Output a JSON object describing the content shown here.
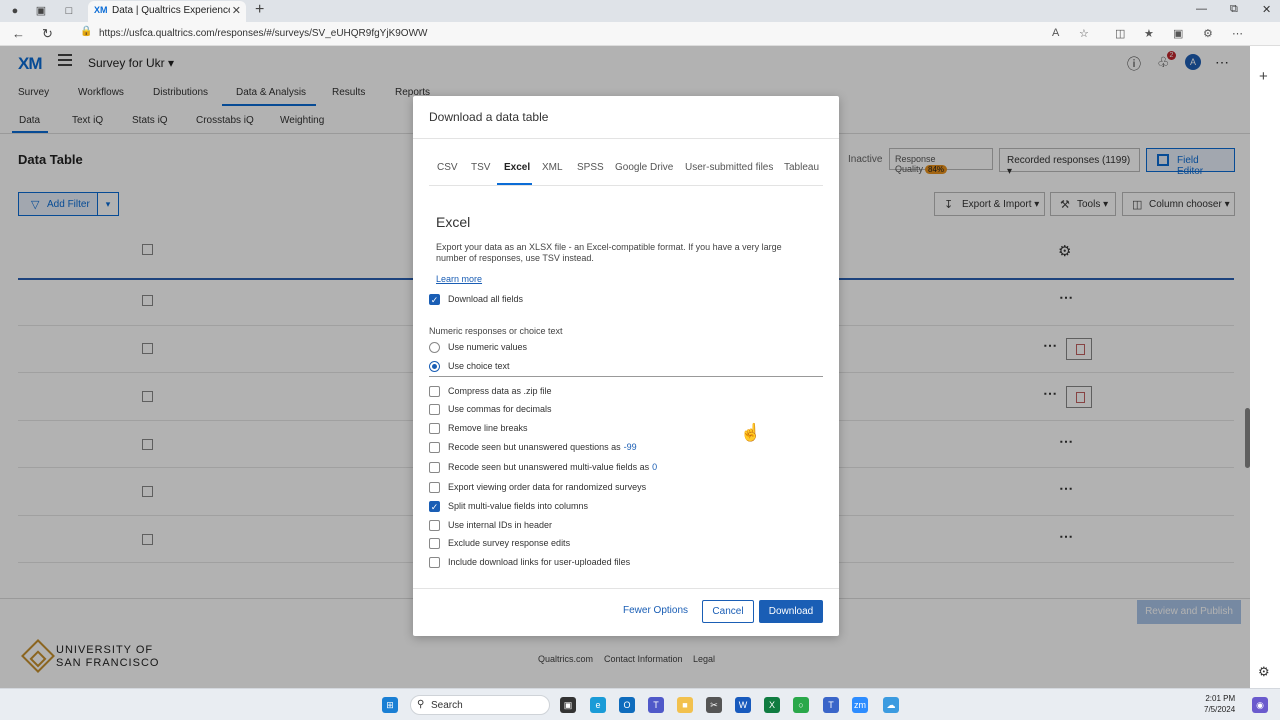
{
  "browser": {
    "tab_title": "Data | Qualtrics Experience Mana",
    "tab_logo": "XM",
    "url": "https://usfca.qualtrics.com/responses/#/surveys/SV_eUHQR9fgYjK9OWW"
  },
  "header": {
    "logo": "XM",
    "project": "Survey for Ukr",
    "avatar_initial": "A",
    "notification_count": "2"
  },
  "main_nav": [
    "Survey",
    "Workflows",
    "Distributions",
    "Data & Analysis",
    "Results",
    "Reports"
  ],
  "sub_nav": [
    "Data",
    "Text iQ",
    "Stats iQ",
    "Crosstabs iQ",
    "Weighting"
  ],
  "toolbar": {
    "title": "Data Table",
    "status": "Inactive",
    "response_quality": "Response Quality",
    "response_quality_pct": "84%",
    "recorded": "Recorded responses (1199)",
    "field_editor": "Field Editor",
    "add_filter": "Add Filter",
    "export_import": "Export & Import",
    "tools": "Tools",
    "column_chooser": "Column chooser"
  },
  "footer": {
    "review_publish": "Review and Publish",
    "school_line1": "UNIVERSITY OF",
    "school_line2": "SAN FRANCISCO",
    "links": [
      "Qualtrics.com",
      "Contact Information",
      "Legal"
    ]
  },
  "modal": {
    "title": "Download a data table",
    "tabs": [
      "CSV",
      "TSV",
      "Excel",
      "XML",
      "SPSS",
      "Google Drive",
      "User-submitted files",
      "Tableau"
    ],
    "active_tab": "Excel",
    "section_title": "Excel",
    "description": "Export your data as an XLSX file - an Excel-compatible format. If you have a very large number of responses, use TSV instead.",
    "learn_more": "Learn more",
    "download_all": "Download all fields",
    "numeric_label": "Numeric responses or choice text",
    "radio_numeric": "Use numeric values",
    "radio_choice": "Use choice text",
    "options": [
      {
        "label": "Compress data as .zip file",
        "checked": false
      },
      {
        "label": "Use commas for decimals",
        "checked": false
      },
      {
        "label": "Remove line breaks",
        "checked": false
      },
      {
        "label": "Recode seen but unanswered questions as",
        "value": "-99",
        "checked": false
      },
      {
        "label": "Recode seen but unanswered multi-value fields as",
        "value": "0",
        "checked": false
      },
      {
        "label": "Export viewing order data for randomized surveys",
        "checked": false
      },
      {
        "label": "Split multi-value fields into columns",
        "checked": true
      },
      {
        "label": "Use internal IDs in header",
        "checked": false
      },
      {
        "label": "Exclude survey response edits",
        "checked": false
      },
      {
        "label": "Include download links for user-uploaded files",
        "checked": false
      }
    ],
    "fewer_options": "Fewer Options",
    "cancel": "Cancel",
    "download": "Download"
  },
  "taskbar": {
    "search": "Search",
    "time": "2:01 PM",
    "date": "7/5/2024"
  },
  "colors": {
    "accent": "#1a5eb5",
    "xm_blue": "#0b6cd6",
    "quality_badge": "#e8911c"
  }
}
